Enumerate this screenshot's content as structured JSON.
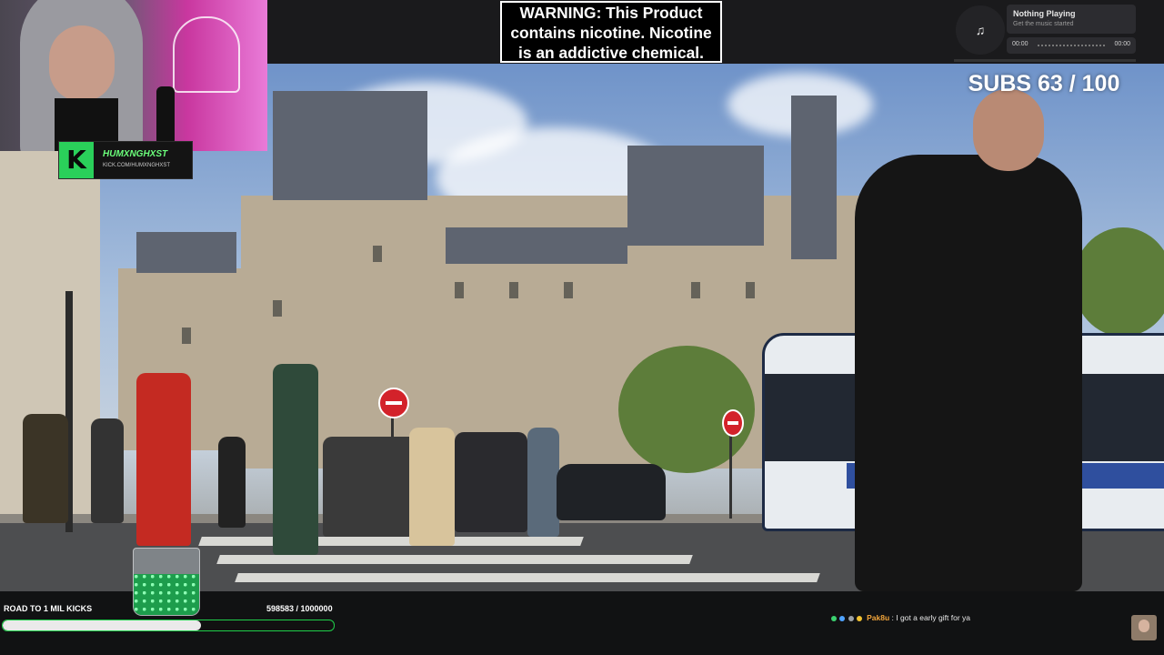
{
  "warning": {
    "line1": "WARNING: This Product",
    "line2": "contains nicotine. Nicotine",
    "line3": "is an addictive chemical."
  },
  "music_player": {
    "title": "Nothing Playing",
    "subtitle": "Get the music started",
    "time_start": "00:00",
    "time_end": "00:00",
    "icon": "music-note-icon"
  },
  "subs_goal": {
    "text": "SUBS 63 / 100",
    "current": 63,
    "target": 100
  },
  "streamer_tag": {
    "name": "HUMXNGHXST",
    "url": "KICK.COM/HUMXNGHXST",
    "logo_letter": "K",
    "accent": "#2ad05a"
  },
  "kicks_goal": {
    "label": "ROAD TO 1 MIL KICKS",
    "count_text": "598583 / 1000000",
    "current": 598583,
    "target": 1000000,
    "progress_fraction": 0.5986
  },
  "chat": {
    "username": "Pak8u",
    "separator": " : ",
    "message": "I got a early gift for ya",
    "username_color": "#f1a43a"
  }
}
